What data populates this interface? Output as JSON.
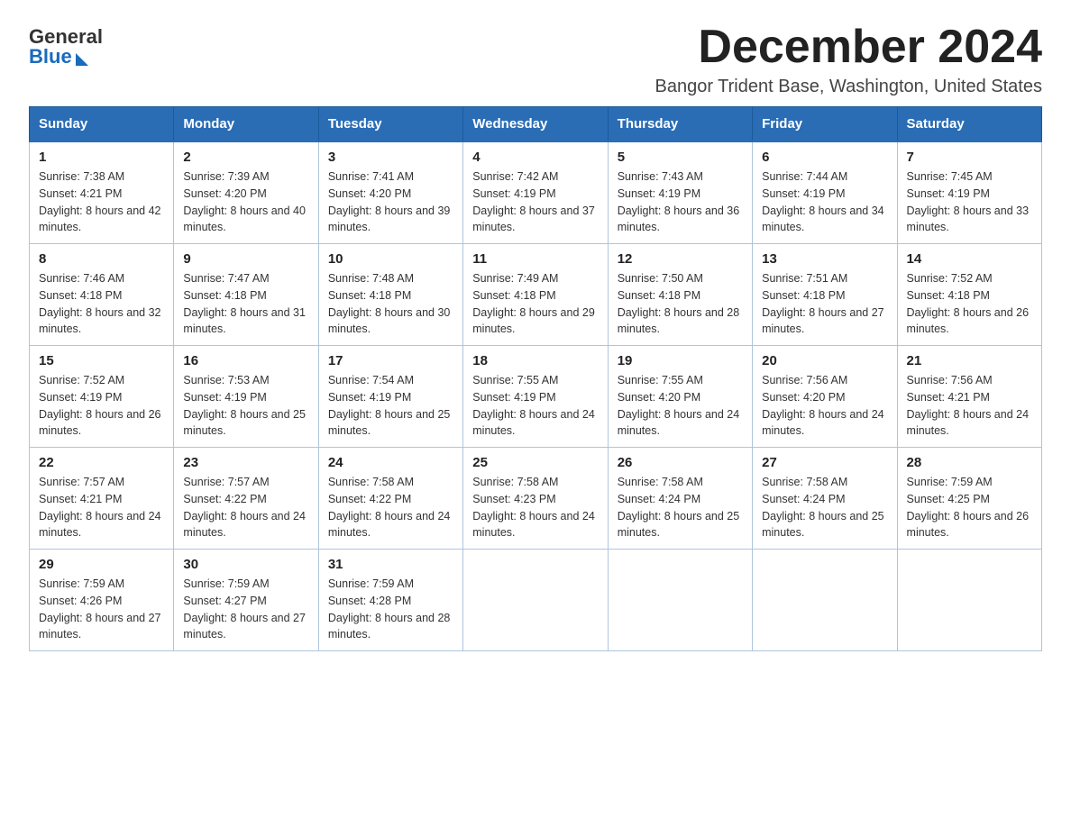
{
  "logo": {
    "general": "General",
    "blue": "Blue"
  },
  "header": {
    "month": "December 2024",
    "location": "Bangor Trident Base, Washington, United States"
  },
  "days_of_week": [
    "Sunday",
    "Monday",
    "Tuesday",
    "Wednesday",
    "Thursday",
    "Friday",
    "Saturday"
  ],
  "weeks": [
    [
      {
        "day": "1",
        "sunrise": "7:38 AM",
        "sunset": "4:21 PM",
        "daylight": "8 hours and 42 minutes."
      },
      {
        "day": "2",
        "sunrise": "7:39 AM",
        "sunset": "4:20 PM",
        "daylight": "8 hours and 40 minutes."
      },
      {
        "day": "3",
        "sunrise": "7:41 AM",
        "sunset": "4:20 PM",
        "daylight": "8 hours and 39 minutes."
      },
      {
        "day": "4",
        "sunrise": "7:42 AM",
        "sunset": "4:19 PM",
        "daylight": "8 hours and 37 minutes."
      },
      {
        "day": "5",
        "sunrise": "7:43 AM",
        "sunset": "4:19 PM",
        "daylight": "8 hours and 36 minutes."
      },
      {
        "day": "6",
        "sunrise": "7:44 AM",
        "sunset": "4:19 PM",
        "daylight": "8 hours and 34 minutes."
      },
      {
        "day": "7",
        "sunrise": "7:45 AM",
        "sunset": "4:19 PM",
        "daylight": "8 hours and 33 minutes."
      }
    ],
    [
      {
        "day": "8",
        "sunrise": "7:46 AM",
        "sunset": "4:18 PM",
        "daylight": "8 hours and 32 minutes."
      },
      {
        "day": "9",
        "sunrise": "7:47 AM",
        "sunset": "4:18 PM",
        "daylight": "8 hours and 31 minutes."
      },
      {
        "day": "10",
        "sunrise": "7:48 AM",
        "sunset": "4:18 PM",
        "daylight": "8 hours and 30 minutes."
      },
      {
        "day": "11",
        "sunrise": "7:49 AM",
        "sunset": "4:18 PM",
        "daylight": "8 hours and 29 minutes."
      },
      {
        "day": "12",
        "sunrise": "7:50 AM",
        "sunset": "4:18 PM",
        "daylight": "8 hours and 28 minutes."
      },
      {
        "day": "13",
        "sunrise": "7:51 AM",
        "sunset": "4:18 PM",
        "daylight": "8 hours and 27 minutes."
      },
      {
        "day": "14",
        "sunrise": "7:52 AM",
        "sunset": "4:18 PM",
        "daylight": "8 hours and 26 minutes."
      }
    ],
    [
      {
        "day": "15",
        "sunrise": "7:52 AM",
        "sunset": "4:19 PM",
        "daylight": "8 hours and 26 minutes."
      },
      {
        "day": "16",
        "sunrise": "7:53 AM",
        "sunset": "4:19 PM",
        "daylight": "8 hours and 25 minutes."
      },
      {
        "day": "17",
        "sunrise": "7:54 AM",
        "sunset": "4:19 PM",
        "daylight": "8 hours and 25 minutes."
      },
      {
        "day": "18",
        "sunrise": "7:55 AM",
        "sunset": "4:19 PM",
        "daylight": "8 hours and 24 minutes."
      },
      {
        "day": "19",
        "sunrise": "7:55 AM",
        "sunset": "4:20 PM",
        "daylight": "8 hours and 24 minutes."
      },
      {
        "day": "20",
        "sunrise": "7:56 AM",
        "sunset": "4:20 PM",
        "daylight": "8 hours and 24 minutes."
      },
      {
        "day": "21",
        "sunrise": "7:56 AM",
        "sunset": "4:21 PM",
        "daylight": "8 hours and 24 minutes."
      }
    ],
    [
      {
        "day": "22",
        "sunrise": "7:57 AM",
        "sunset": "4:21 PM",
        "daylight": "8 hours and 24 minutes."
      },
      {
        "day": "23",
        "sunrise": "7:57 AM",
        "sunset": "4:22 PM",
        "daylight": "8 hours and 24 minutes."
      },
      {
        "day": "24",
        "sunrise": "7:58 AM",
        "sunset": "4:22 PM",
        "daylight": "8 hours and 24 minutes."
      },
      {
        "day": "25",
        "sunrise": "7:58 AM",
        "sunset": "4:23 PM",
        "daylight": "8 hours and 24 minutes."
      },
      {
        "day": "26",
        "sunrise": "7:58 AM",
        "sunset": "4:24 PM",
        "daylight": "8 hours and 25 minutes."
      },
      {
        "day": "27",
        "sunrise": "7:58 AM",
        "sunset": "4:24 PM",
        "daylight": "8 hours and 25 minutes."
      },
      {
        "day": "28",
        "sunrise": "7:59 AM",
        "sunset": "4:25 PM",
        "daylight": "8 hours and 26 minutes."
      }
    ],
    [
      {
        "day": "29",
        "sunrise": "7:59 AM",
        "sunset": "4:26 PM",
        "daylight": "8 hours and 27 minutes."
      },
      {
        "day": "30",
        "sunrise": "7:59 AM",
        "sunset": "4:27 PM",
        "daylight": "8 hours and 27 minutes."
      },
      {
        "day": "31",
        "sunrise": "7:59 AM",
        "sunset": "4:28 PM",
        "daylight": "8 hours and 28 minutes."
      },
      null,
      null,
      null,
      null
    ]
  ]
}
